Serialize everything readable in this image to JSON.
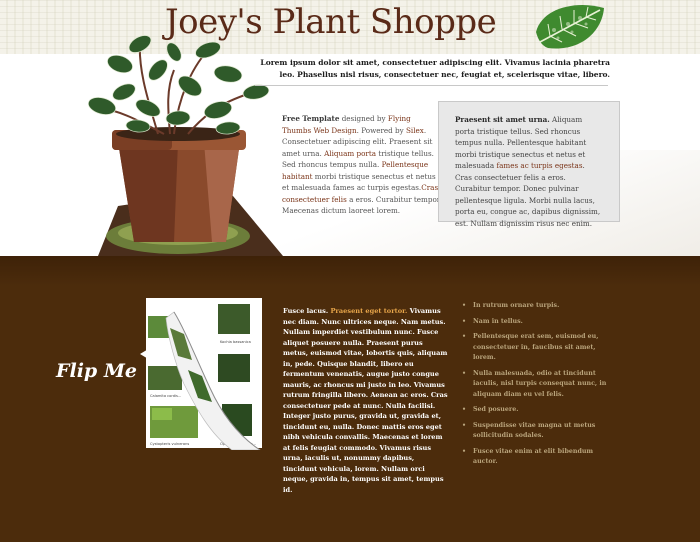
{
  "header": {
    "title": "Joey's Plant Shoppe",
    "intro": "Lorem ipsum dolor sit amet, consectetuer adipiscing elit. Vivamus lacinia pharetra leo. Phasellus nisl risus, consectetuer nec, feugiat et, scelerisque vitae, libero."
  },
  "column1": {
    "lead": "Free Template",
    "t1": " designed by ",
    "link_author": "Flying Thumbs Web Design",
    "t2": ". Powered by ",
    "link_powered": "Silex",
    "t3": ". Consectetuer adipiscing elit. Praesent sit amet urna. ",
    "link_aliquam": "Aliquam porta",
    "t4": " tristique tellus. Sed rhoncus tempus nulla. ",
    "link_pellentesque": "Pellentesque habitant",
    "t5": " morbi tristique senectus et netus et malesuada fames ac turpis egestas.",
    "link_cras": "Cras consectetuer felis",
    "t6": " a eros. Curabitur tempor. Maecenas dictum laoreet lorem."
  },
  "box": {
    "lead": "Praesent sit amet urna.",
    "t1": " Aliquam porta tristique tellus. Sed rhoncus tempus nulla. Pellentesque habitant morbi tristique senectus et netus et malesuada ",
    "link": "fames ac turpis egestas",
    "t2": ". Cras consectetuer felis a eros. Curabitur tempor. Donec pulvinar pellentesque ligula. Morbi nulla lacus, porta eu, congue ac, dapibus dignissim, est. Nullam dignissim risus nec enim."
  },
  "flip": {
    "label": "Flip Me",
    "captions": [
      "Kochia bassanica",
      "Calamita cordis...",
      "Cystopteris vulnerans",
      "Ophioglossum tub..."
    ]
  },
  "column3": {
    "t1": "Fusce lacus. ",
    "highlight": "Praesent eget tortor.",
    "t2": " Vivamus nec diam. Nunc ultrices neque. Nam metus. Nullam imperdiet vestibulum nunc. Fusce aliquet posuere nulla. Praesent purus metus, euismod vitae, lobortis quis, aliquam in, pede. Quisque blandit, libero eu fermentum venenatis, augue justo congue mauris, ac rhoncus mi justo in leo. Vivamus rutrum fringilla libero. Aenean ac eros. Cras consectetuer pede at nunc. Nulla facilisi. Integer justo purus, gravida ut, gravida et, tincidunt eu, nulla. Donec mattis eros eget nibh vehicula convallis. Maecenas et lorem at felis feugiat commodo. Vivamus risus urna, iaculis ut, nonummy dapibus, tincidunt vehicula, lorem. Nullam orci neque, gravida in, tempus sit amet, tempus id."
  },
  "list": {
    "items": [
      "In rutrum ornare turpis.",
      "Nam in tellus.",
      "Pellentesque erat sem, euismod eu, consectetuer in, faucibus sit amet, lorem.",
      "Nulla malesuada, odio at tincidunt iaculis, nisl turpis consequat nunc, in aliquam diam eu vel felis.",
      "Sed posuere.",
      "Suspendisse vitae magna ut metus sollicitudin sodales.",
      "Fusce vitae enim at elit bibendum auctor."
    ]
  },
  "colors": {
    "brown_bg": "#4c2c0c",
    "title": "#5a2a18",
    "link": "#7a3418",
    "highlight": "#e8a64a",
    "list_text": "#b9a47c"
  }
}
